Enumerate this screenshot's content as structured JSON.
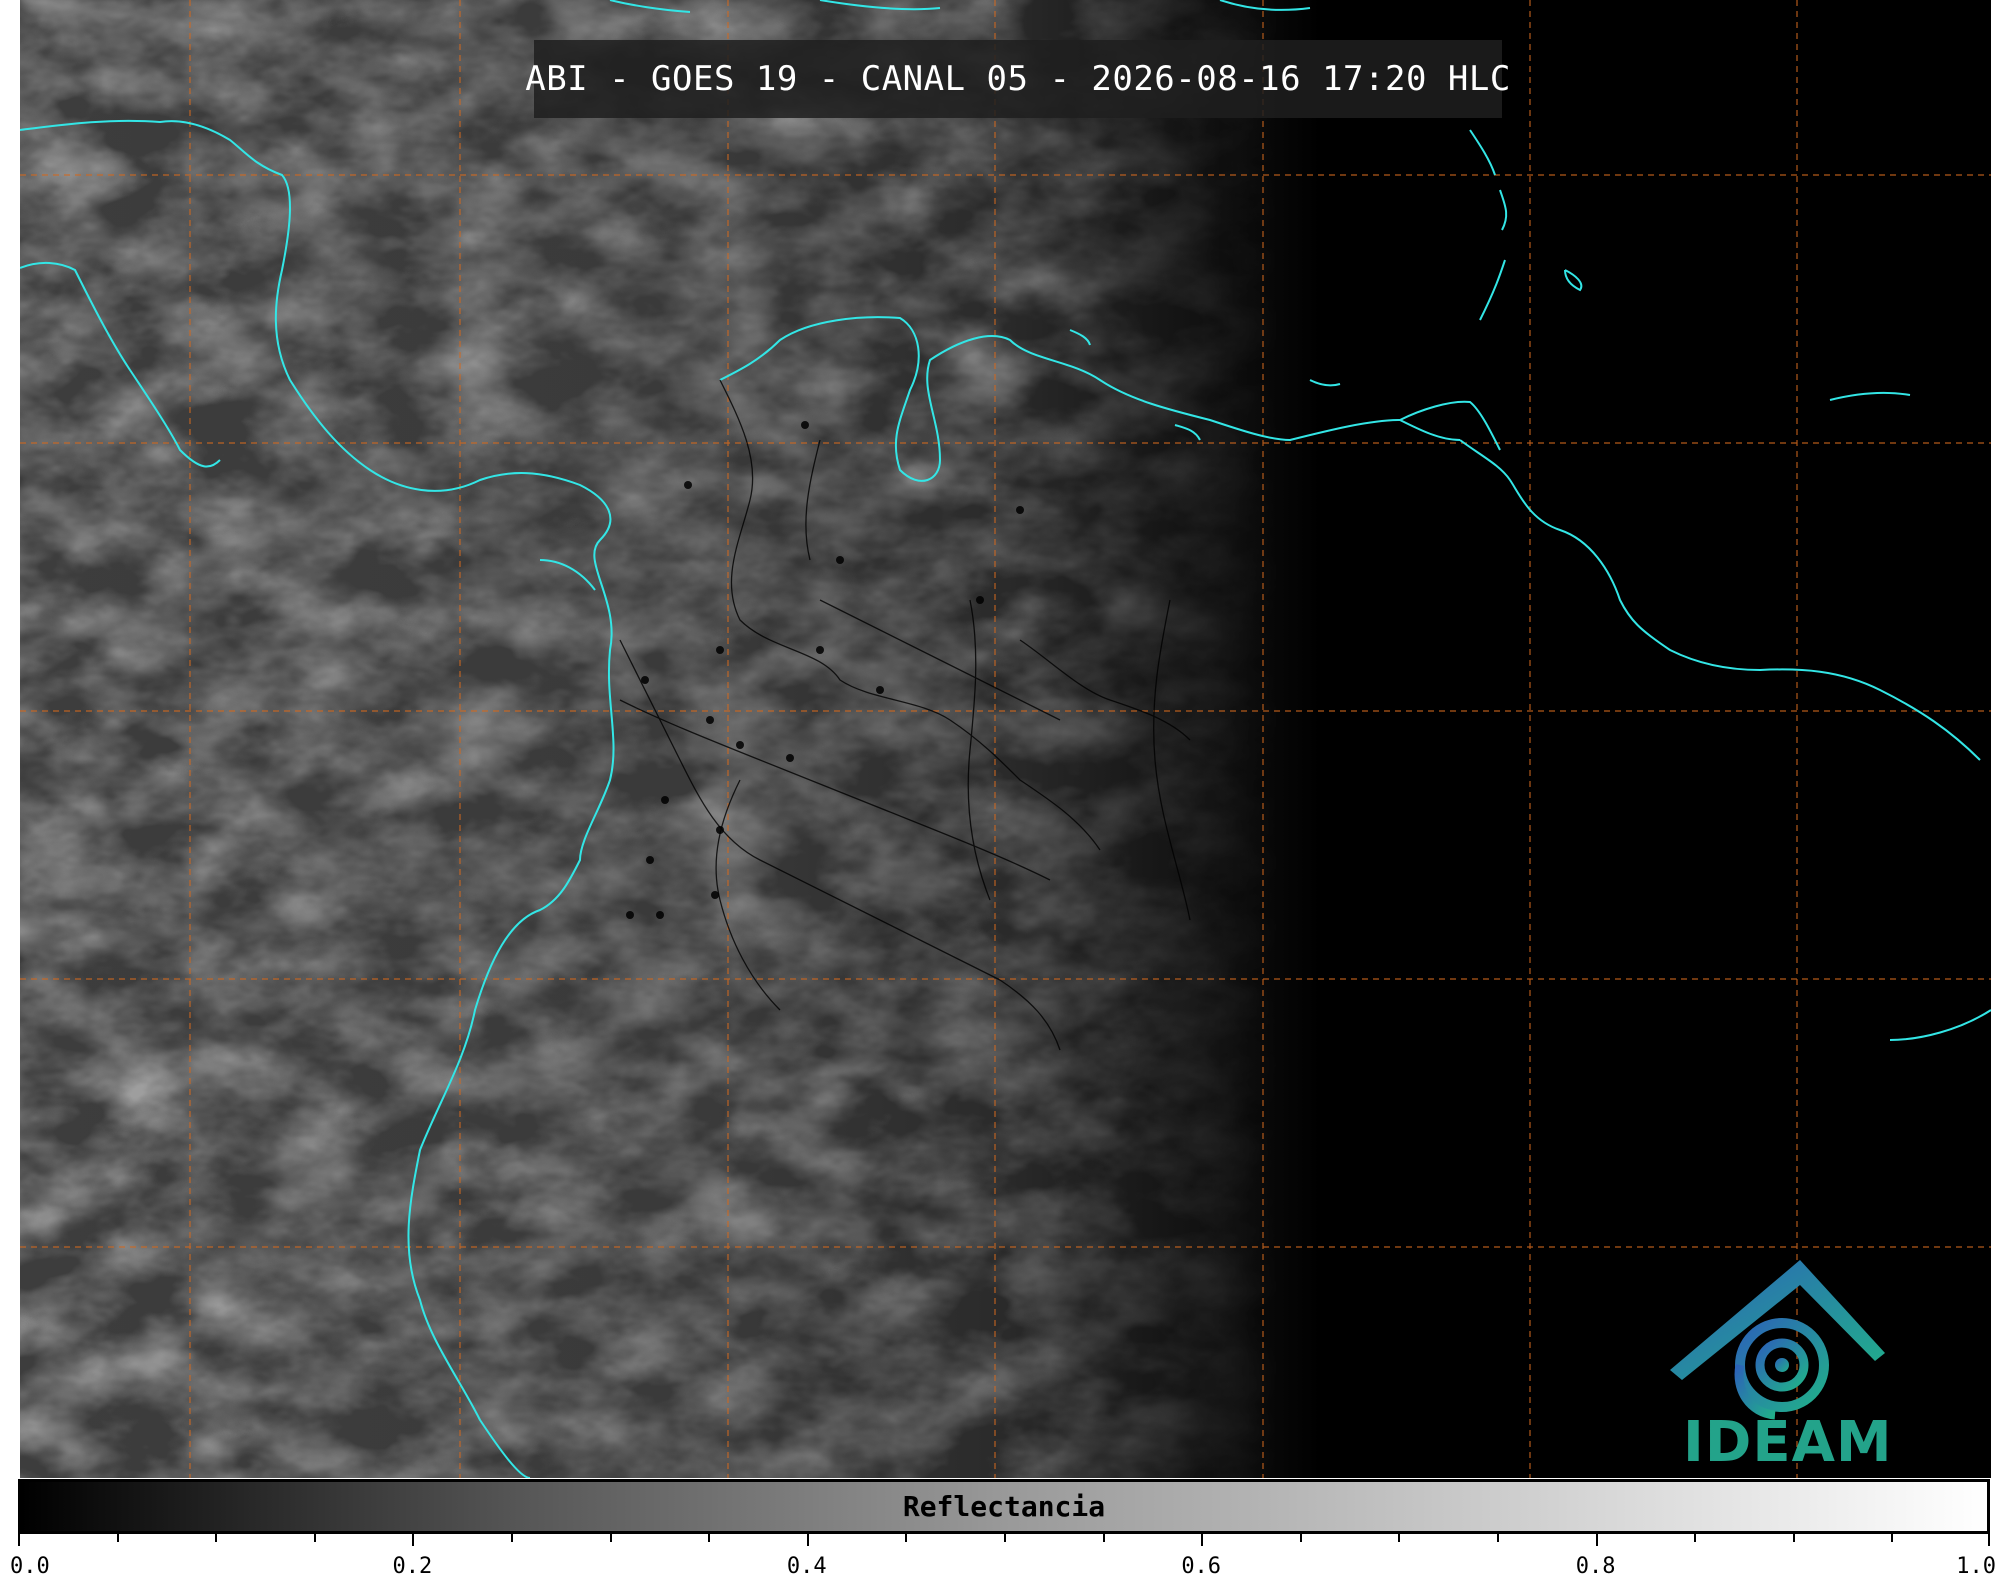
{
  "title": "ABI - GOES 19 - CANAL 05 - 2026-08-16 17:20 HLC",
  "logo": {
    "text": "IDEAM",
    "icon": "ideam-logo-icon"
  },
  "colorbar": {
    "label": "Reflectancia",
    "min": 0.0,
    "max": 1.0,
    "tick_labels": [
      "0.0",
      "0.2",
      "0.4",
      "0.6",
      "0.8",
      "1.0"
    ],
    "minor_step": 0.05
  },
  "colors": {
    "coastline": "#33e6e6",
    "grid": "#d2691e",
    "borders": "#000000",
    "night": "#000000",
    "cloud": "#4a4a4a"
  }
}
